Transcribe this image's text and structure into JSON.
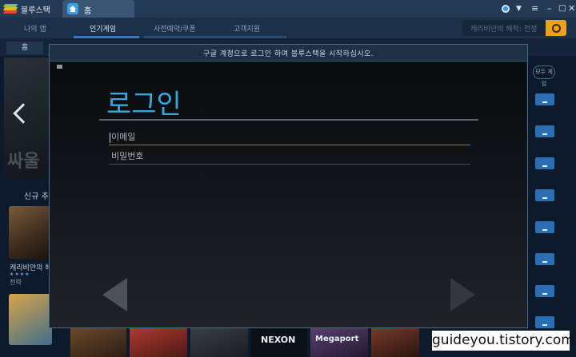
{
  "app": {
    "title": "블루스택",
    "tab_label": "홈"
  },
  "nav": {
    "items": [
      "나의 앱",
      "인기게임",
      "사전예약/쿠폰",
      "고객지원"
    ],
    "active_index": 1,
    "search_placeholder": "캐리비안의 해적: 전쟁"
  },
  "subnav": {
    "tab_label": "홈"
  },
  "background": {
    "banner_text": "싸울",
    "section_title": "신규 추",
    "game1_name": "캐리비안의 해",
    "game1_rating": 4,
    "game1_genre": "전략",
    "right_pill": "모두 게임",
    "strip_labels": [
      "NEXON",
      "Megaport"
    ]
  },
  "dialog": {
    "header_message": "구글 계정으로 로그인 하여 블루스택을 시작하십시오.",
    "title": "로그인",
    "email_placeholder": "이메일",
    "password_placeholder": "비밀번호"
  },
  "watermark": "guideyou.tistory.com",
  "colors": {
    "accent": "#34a8dd",
    "tab_underline": "#2f79c8",
    "search_button": "#e9a21e",
    "window_bg": "#0c1828"
  }
}
